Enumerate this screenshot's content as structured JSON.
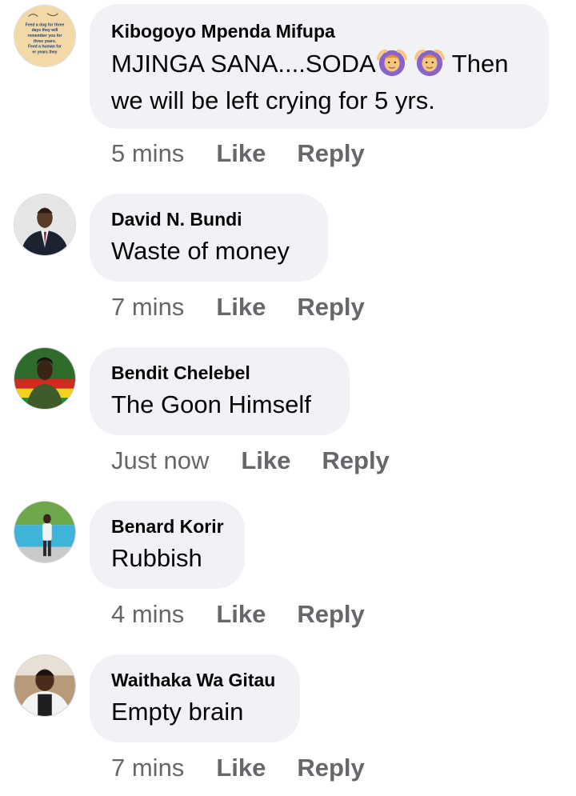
{
  "comments": [
    {
      "author": "Kibogoyo Mpenda Mifupa",
      "text_line1_a": "MJINGA SANA....SODA",
      "text_line1_b": " Then",
      "text_line2": "we will be left crying for 5 yrs.",
      "time": "5 mins",
      "like": "Like",
      "reply": "Reply",
      "avatar_lines": [
        "Feed a dog for three",
        "days they will",
        "remember you for",
        "three years.",
        "Feed a human for",
        "er years they"
      ],
      "emoji_icon": "person-gesturing-ok-icon"
    },
    {
      "author": "David N. Bundi",
      "text": "Waste of money",
      "time": "7 mins",
      "like": "Like",
      "reply": "Reply"
    },
    {
      "author": "Bendit Chelebel",
      "text": "The Goon Himself",
      "time": "Just now",
      "like": "Like",
      "reply": "Reply"
    },
    {
      "author": "Benard Korir",
      "text": "Rubbish",
      "time": "4 mins",
      "like": "Like",
      "reply": "Reply"
    },
    {
      "author": "Waithaka Wa Gitau",
      "text": "Empty brain",
      "time": "7 mins",
      "like": "Like",
      "reply": "Reply"
    }
  ],
  "colors": {
    "bubble": "#f0f2f5",
    "text": "#050505",
    "meta": "#65676b"
  }
}
